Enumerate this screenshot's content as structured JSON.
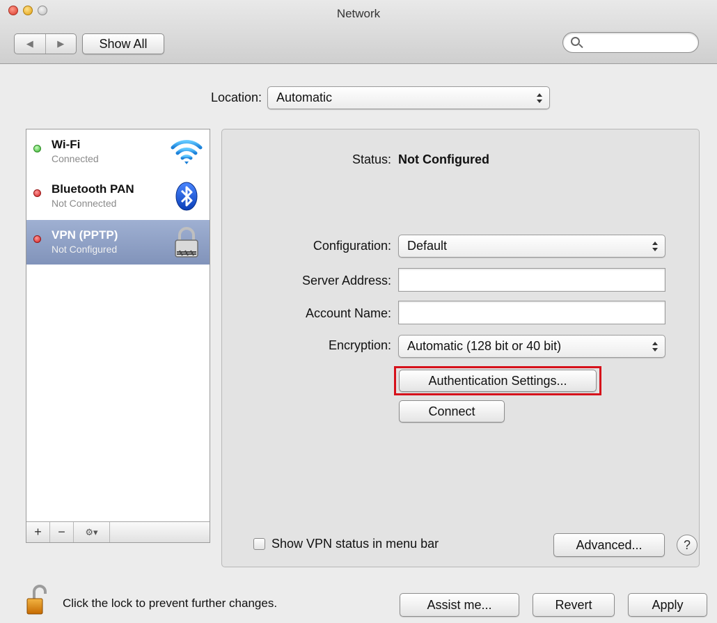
{
  "window": {
    "title": "Network"
  },
  "toolbar": {
    "back_glyph": "◀",
    "forward_glyph": "▶",
    "show_all_label": "Show All",
    "search_placeholder": "",
    "search_icon": "magnifier-icon"
  },
  "location": {
    "label": "Location:",
    "value": "Automatic"
  },
  "services": [
    {
      "name": "Wi-Fi",
      "status": "Connected",
      "status_color": "green",
      "icon": "wifi-icon",
      "selected": false
    },
    {
      "name": "Bluetooth PAN",
      "status": "Not Connected",
      "status_color": "red",
      "icon": "bluetooth-icon",
      "selected": false
    },
    {
      "name": "VPN (PPTP)",
      "status": "Not Configured",
      "status_color": "red",
      "icon": "vpn-lock-icon",
      "selected": true
    }
  ],
  "sidebar_footer": {
    "add_label": "+",
    "remove_label": "−",
    "gear_label": "⚙▾"
  },
  "detail": {
    "status_label": "Status:",
    "status_value": "Not Configured",
    "configuration_label": "Configuration:",
    "configuration_value": "Default",
    "server_address_label": "Server Address:",
    "server_address_value": "",
    "account_name_label": "Account Name:",
    "account_name_value": "",
    "encryption_label": "Encryption:",
    "encryption_value": "Automatic (128 bit or 40 bit)",
    "auth_settings_label": "Authentication Settings...",
    "connect_label": "Connect",
    "show_vpn_status_label": "Show VPN status in menu bar",
    "advanced_label": "Advanced...",
    "help_label": "?"
  },
  "footer": {
    "lock_text": "Click the lock to prevent further changes.",
    "assist_label": "Assist me...",
    "revert_label": "Revert",
    "apply_label": "Apply"
  },
  "colors": {
    "highlight": "#d6111b",
    "selection": "#8ea0c6",
    "status_green": "#33b02a",
    "status_red": "#d01e1e"
  }
}
